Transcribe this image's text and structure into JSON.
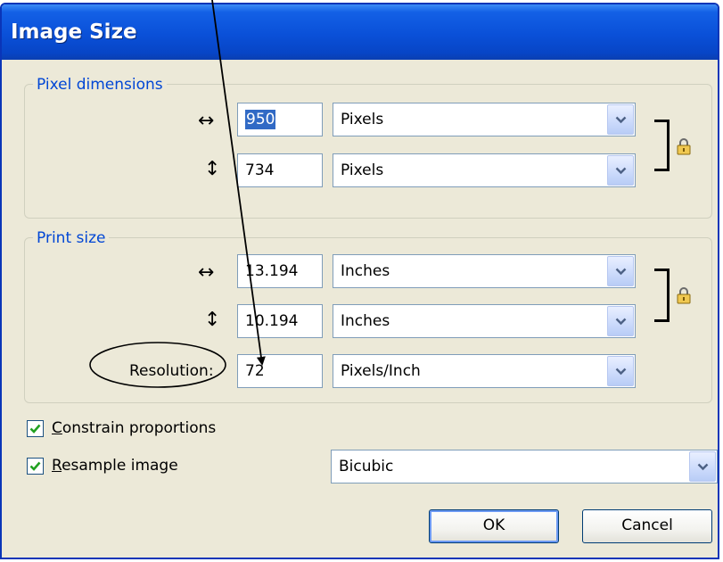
{
  "window": {
    "title": "Image Size"
  },
  "pixel_dimensions": {
    "legend": "Pixel dimensions",
    "width": {
      "value": "950",
      "unit": "Pixels"
    },
    "height": {
      "value": "734",
      "unit": "Pixels"
    }
  },
  "print_size": {
    "legend": "Print size",
    "width": {
      "value": "13.194",
      "unit": "Inches"
    },
    "height": {
      "value": "10.194",
      "unit": "Inches"
    },
    "resolution": {
      "label": "Resolution:",
      "value": "72",
      "unit": "Pixels/Inch"
    }
  },
  "options": {
    "constrain": {
      "label_first": "C",
      "label_rest": "onstrain proportions",
      "checked": true
    },
    "resample": {
      "label_first": "R",
      "label_rest": "esample image",
      "checked": true,
      "method": "Bicubic"
    }
  },
  "buttons": {
    "ok": "OK",
    "cancel": "Cancel"
  },
  "icons": {
    "width_arrow": "↔",
    "height_arrow": "↕",
    "dropdown": "chevron-down-icon",
    "lock": "lock-icon",
    "check": "checkmark-icon"
  },
  "colors": {
    "titlebar": "#0a50d8",
    "legend_text": "#0046d5",
    "selection": "#316ac5",
    "dialog_bg": "#ece9d8"
  }
}
